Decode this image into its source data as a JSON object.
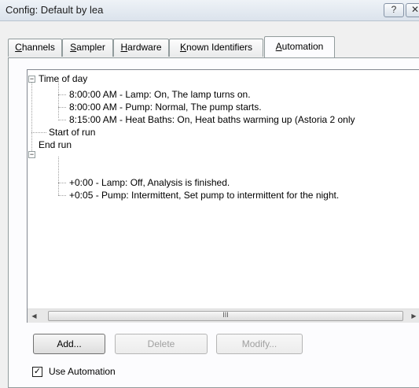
{
  "window": {
    "title": "Config: Default by lea",
    "help_glyph": "?",
    "close_glyph": "✕"
  },
  "tabs": [
    {
      "label": "Channels",
      "mnemonic": "C",
      "rest": "hannels"
    },
    {
      "label": "Sampler",
      "mnemonic": "S",
      "rest": "ampler"
    },
    {
      "label": "Hardware",
      "mnemonic": "H",
      "rest": "ardware"
    },
    {
      "label": "Known Identifiers",
      "mnemonic": "K",
      "rest": "nown Identifiers"
    },
    {
      "label": "Automation",
      "mnemonic": "A",
      "rest": "utomation",
      "active": true
    }
  ],
  "tree": {
    "groups": [
      {
        "label": "Time of day",
        "expander": "−",
        "items": [
          "8:00:00 AM - Lamp: On, The lamp turns on.",
          "8:00:00 AM - Pump: Normal, The pump starts.",
          "8:15:00 AM - Heat Baths: On,   Heat baths warming up (Astoria 2 only"
        ]
      },
      {
        "label": "Start of run",
        "items": []
      },
      {
        "label": "End run",
        "expander": "−",
        "items": [
          "+0:00 - Lamp: Off, Analysis is finished.",
          "+0:05 - Pump: Intermittent,   Set pump to intermittent for the night."
        ]
      }
    ]
  },
  "scrollbar": {
    "left_arrow": "◀",
    "right_arrow": "▶",
    "thumb_grip": "III"
  },
  "buttons": {
    "add": "Add...",
    "delete": "Delete",
    "modify": "Modify..."
  },
  "use_automation": {
    "label": "Use Automation",
    "checked": true,
    "check_glyph": "✓"
  }
}
